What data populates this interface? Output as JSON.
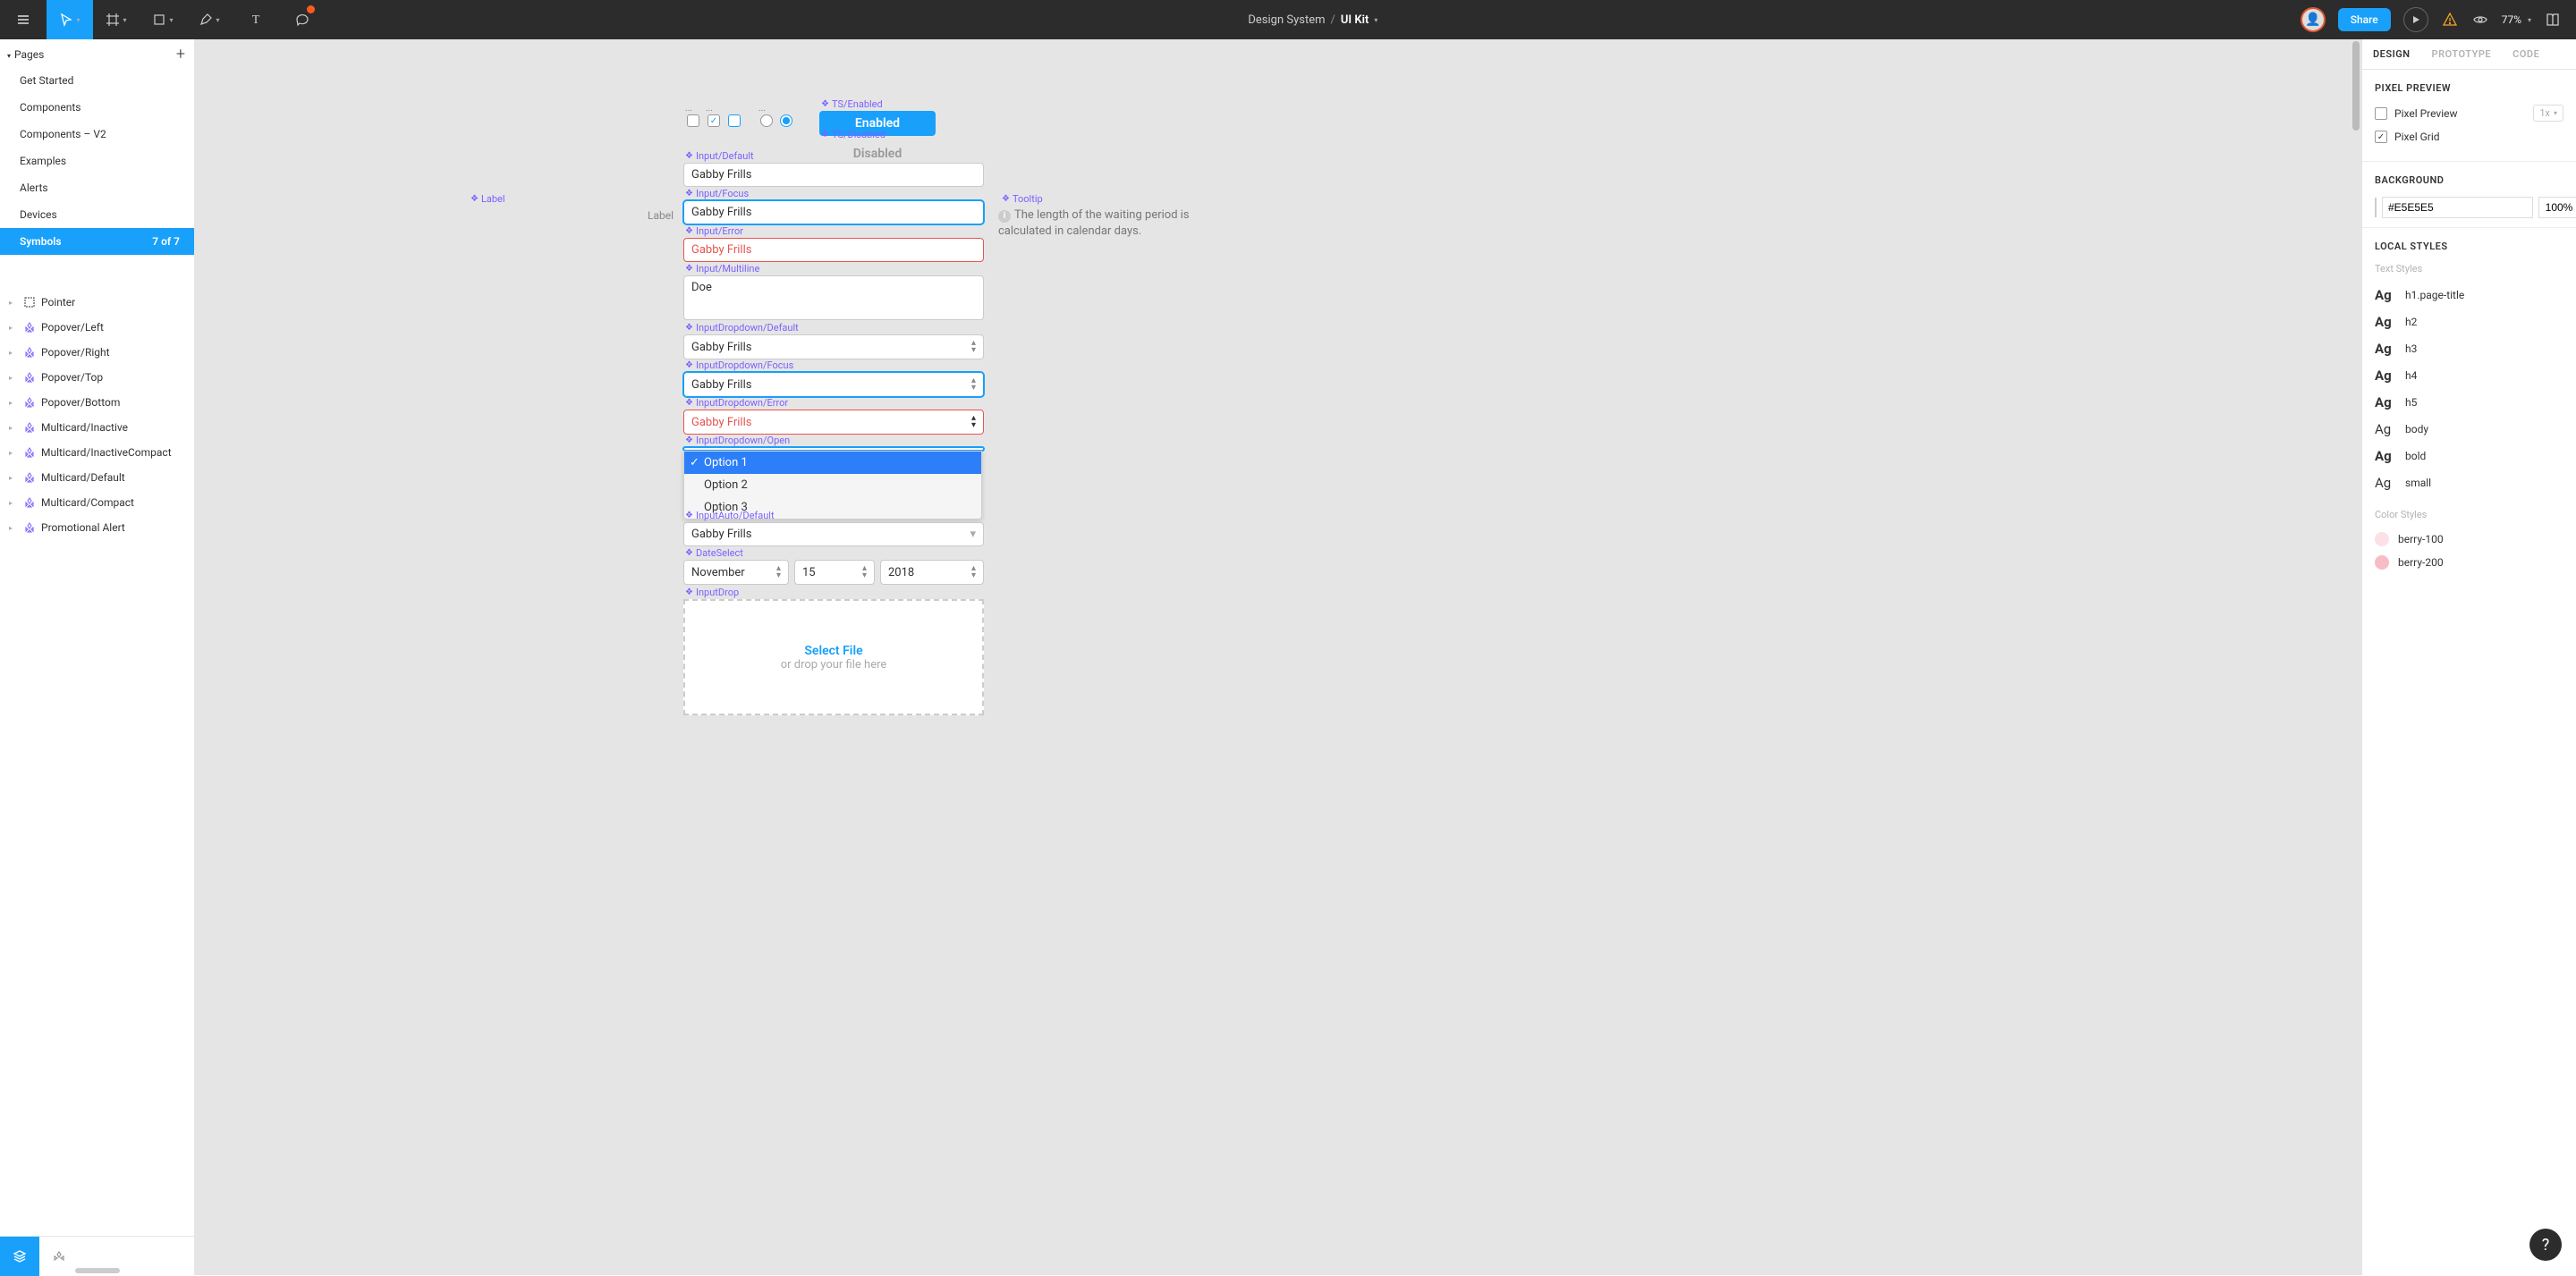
{
  "toolbar": {
    "breadcrumb_project": "Design System",
    "breadcrumb_file": "UI Kit",
    "share_label": "Share",
    "zoom": "77%"
  },
  "left": {
    "pages_title": "Pages",
    "pages": [
      {
        "label": "Get Started"
      },
      {
        "label": "Components"
      },
      {
        "label": "Components – V2"
      },
      {
        "label": "Examples"
      },
      {
        "label": "Alerts"
      },
      {
        "label": "Devices"
      }
    ],
    "active_page": {
      "label": "Symbols",
      "count": "7 of 7"
    },
    "layers": [
      {
        "label": "Pointer",
        "frame": true
      },
      {
        "label": "Popover/Left"
      },
      {
        "label": "Popover/Right"
      },
      {
        "label": "Popover/Top"
      },
      {
        "label": "Popover/Bottom"
      },
      {
        "label": "Multicard/Inactive"
      },
      {
        "label": "Multicard/InactiveCompact"
      },
      {
        "label": "Multicard/Default"
      },
      {
        "label": "Multicard/Compact"
      },
      {
        "label": "Promotional Alert"
      }
    ]
  },
  "canvas": {
    "label_text": "Label",
    "cmp_label": "Label",
    "cmp_ts_enabled": "TS/Enabled",
    "cmp_ts_disabled": "TS/Disabled",
    "enabled_text": "Enabled",
    "disabled_text": "Disabled",
    "cmp_input_default": "Input/Default",
    "cmp_input_focus": "Input/Focus",
    "cmp_input_error": "Input/Error",
    "cmp_input_multiline": "Input/Multiline",
    "cmp_dd_default": "InputDropdown/Default",
    "cmp_dd_focus": "InputDropdown/Focus",
    "cmp_dd_error": "InputDropdown/Error",
    "cmp_dd_open": "InputDropdown/Open",
    "cmp_auto_default": "InputAuto/Default",
    "cmp_date": "DateSelect",
    "cmp_drop": "InputDrop",
    "cmp_tooltip": "Tooltip",
    "input_value": "Gabby Frills",
    "multiline_value": "Doe",
    "dd_options": [
      "Option 1",
      "Option 2",
      "Option 3"
    ],
    "date_month": "November",
    "date_day": "15",
    "date_year": "2018",
    "drop_title": "Select File",
    "drop_sub": "or drop your file here",
    "tooltip_text": "The length of the waiting period is calculated in calendar days."
  },
  "right": {
    "tabs": {
      "design": "DESIGN",
      "prototype": "PROTOTYPE",
      "code": "CODE"
    },
    "pixel_preview_title": "PIXEL PREVIEW",
    "pixel_preview_label": "Pixel Preview",
    "pixel_grid_label": "Pixel Grid",
    "preview_scale": "1x",
    "background_title": "BACKGROUND",
    "bg_hex": "#E5E5E5",
    "bg_opacity": "100%",
    "local_styles_title": "LOCAL STYLES",
    "text_styles_title": "Text Styles",
    "text_styles": [
      {
        "name": "h1.page-title",
        "bold": true
      },
      {
        "name": "h2",
        "bold": true
      },
      {
        "name": "h3",
        "bold": true
      },
      {
        "name": "h4",
        "bold": true
      },
      {
        "name": "h5",
        "bold": true
      },
      {
        "name": "body",
        "bold": false
      },
      {
        "name": "bold",
        "bold": true
      },
      {
        "name": "small",
        "bold": false
      }
    ],
    "color_styles_title": "Color Styles",
    "color_styles": [
      {
        "name": "berry-100",
        "hex": "#fbe0e5"
      },
      {
        "name": "berry-200",
        "hex": "#f7bcc6"
      }
    ]
  },
  "help": "?"
}
